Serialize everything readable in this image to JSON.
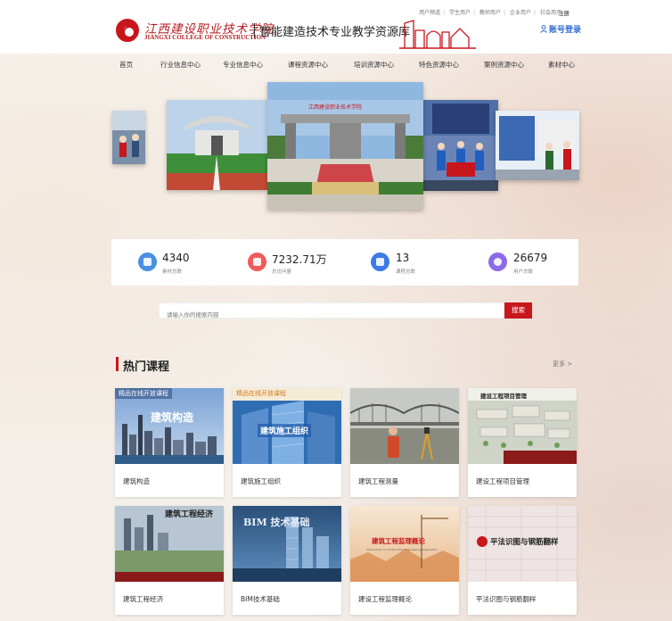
{
  "header": {
    "top_links": [
      "用户频道",
      "学生用户",
      "教师用户",
      "企业用户",
      "社会用户"
    ],
    "register": "注册",
    "school_name_cn": "江西建设职业技术学院",
    "school_name_en": "JIANGXI COLLEGE OF CONSTRUCTION",
    "site_title": "智能建造技术专业教学资源库",
    "login": "账号登录"
  },
  "nav": {
    "items": [
      "首页",
      "行业信息中心",
      "专业信息中心",
      "课程资源中心",
      "培训资源中心",
      "特色资源中心",
      "案例资源中心",
      "素材中心"
    ]
  },
  "carousel": {
    "banner_text": "江西建设职业技术学院"
  },
  "stats": [
    {
      "value": "4340",
      "label": "素材总数",
      "color": "#4a90e2"
    },
    {
      "value": "7232.71万",
      "label": "总访问量",
      "color": "#f05a5a"
    },
    {
      "value": "13",
      "label": "课程总数",
      "color": "#3d7ae8"
    },
    {
      "value": "26679",
      "label": "用户总数",
      "color": "#8d6be8"
    }
  ],
  "search": {
    "placeholder": "请输入你的搜索内容",
    "button": "搜索"
  },
  "hot_courses": {
    "title": "热门课程",
    "more": "更多 >",
    "courses": [
      {
        "name": "建筑构造",
        "thumb_badge": "精品在线开放课程",
        "thumb_title": "建筑构造"
      },
      {
        "name": "建筑施工组织",
        "thumb_badge": "精品在线开放课程",
        "thumb_title": "建筑施工组织"
      },
      {
        "name": "建筑工程测量",
        "thumb_badge": "",
        "thumb_title": ""
      },
      {
        "name": "建设工程项目管理",
        "thumb_badge": "",
        "thumb_title": "建设工程项目管理"
      },
      {
        "name": "建筑工程经济",
        "thumb_badge": "",
        "thumb_title": "建筑工程经济"
      },
      {
        "name": "BIM技术基础",
        "thumb_badge": "",
        "thumb_title": "BIM 技术基础"
      },
      {
        "name": "建设工程监理概论",
        "thumb_badge": "",
        "thumb_title": "建筑工程监理概论",
        "thumb_sub": "Introduction to Construction Engineering Supervision"
      },
      {
        "name": "平法识图与钢筋翻样",
        "thumb_badge": "",
        "thumb_title": "平法识图与钢筋翻样"
      }
    ]
  },
  "colors": {
    "brand_red": "#c8161d",
    "link_blue": "#2e6ad1"
  }
}
